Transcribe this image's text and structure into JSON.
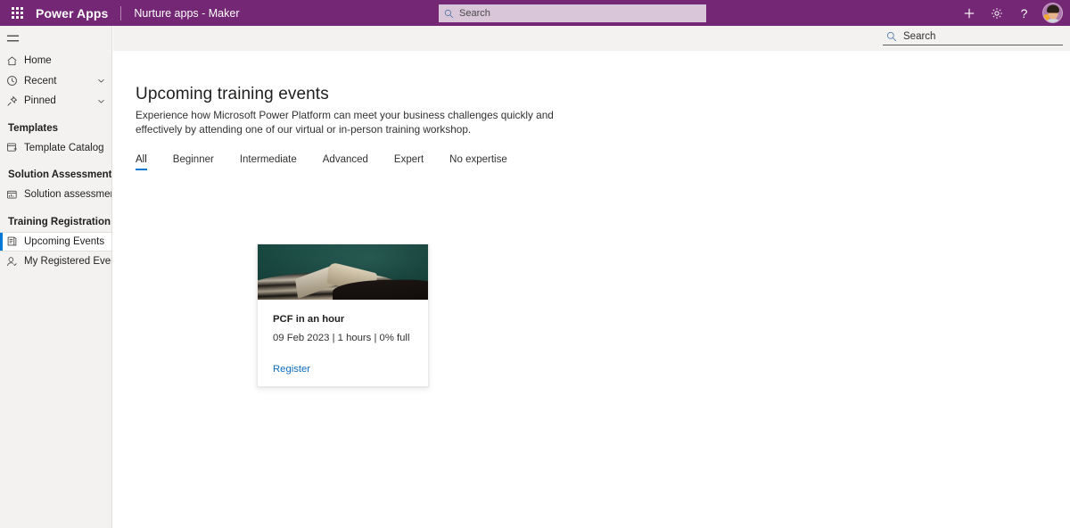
{
  "header": {
    "waffle_name": "app-launcher",
    "brand": "Power Apps",
    "environment": "Nurture apps - Maker",
    "search_placeholder": "Search",
    "actions": [
      {
        "name": "new-button",
        "glyph": "+"
      },
      {
        "name": "settings-button",
        "glyph": "gear"
      },
      {
        "name": "help-button",
        "glyph": "?"
      }
    ],
    "avatar_label": "user-avatar",
    "background_color": "#742774"
  },
  "command_bar": {
    "search_placeholder": "Search"
  },
  "sidebar": {
    "hamburger_label": "menu-toggle",
    "items": [
      {
        "label": "Home",
        "icon": "home-icon",
        "chevron": false,
        "active": false
      },
      {
        "label": "Recent",
        "icon": "clock-icon",
        "chevron": true,
        "active": false
      },
      {
        "label": "Pinned",
        "icon": "pin-icon",
        "chevron": true,
        "active": false
      }
    ],
    "groups": [
      {
        "title": "Templates",
        "items": [
          {
            "label": "Template Catalog",
            "icon": "template-catalog-icon",
            "active": false
          }
        ]
      },
      {
        "title": "Solution Assessment",
        "items": [
          {
            "label": "Solution assessment",
            "icon": "solution-assessment-icon",
            "active": false
          }
        ]
      },
      {
        "title": "Training Registration",
        "items": [
          {
            "label": "Upcoming Events",
            "icon": "upcoming-events-icon",
            "active": true
          },
          {
            "label": "My Registered Events",
            "icon": "person-icon",
            "active": false
          }
        ]
      }
    ],
    "active_indicator_color": "#0078d4"
  },
  "main": {
    "title": "Upcoming training events",
    "description": "Experience how Microsoft Power Platform can meet your business challenges quickly and effectively by attending one of our virtual or in-person training workshop.",
    "tabs": [
      {
        "label": "All",
        "selected": true
      },
      {
        "label": "Beginner",
        "selected": false
      },
      {
        "label": "Intermediate",
        "selected": false
      },
      {
        "label": "Advanced",
        "selected": false
      },
      {
        "label": "Expert",
        "selected": false
      },
      {
        "label": "No expertise",
        "selected": false
      }
    ],
    "tab_accent_color": "#0078d4",
    "cards": [
      {
        "image_name": "open-book-photo",
        "title": "PCF in an hour",
        "meta": "09 Feb 2023 | 1 hours | 0% full",
        "link_label": "Register",
        "link_color": "#0f6cbd"
      }
    ]
  }
}
